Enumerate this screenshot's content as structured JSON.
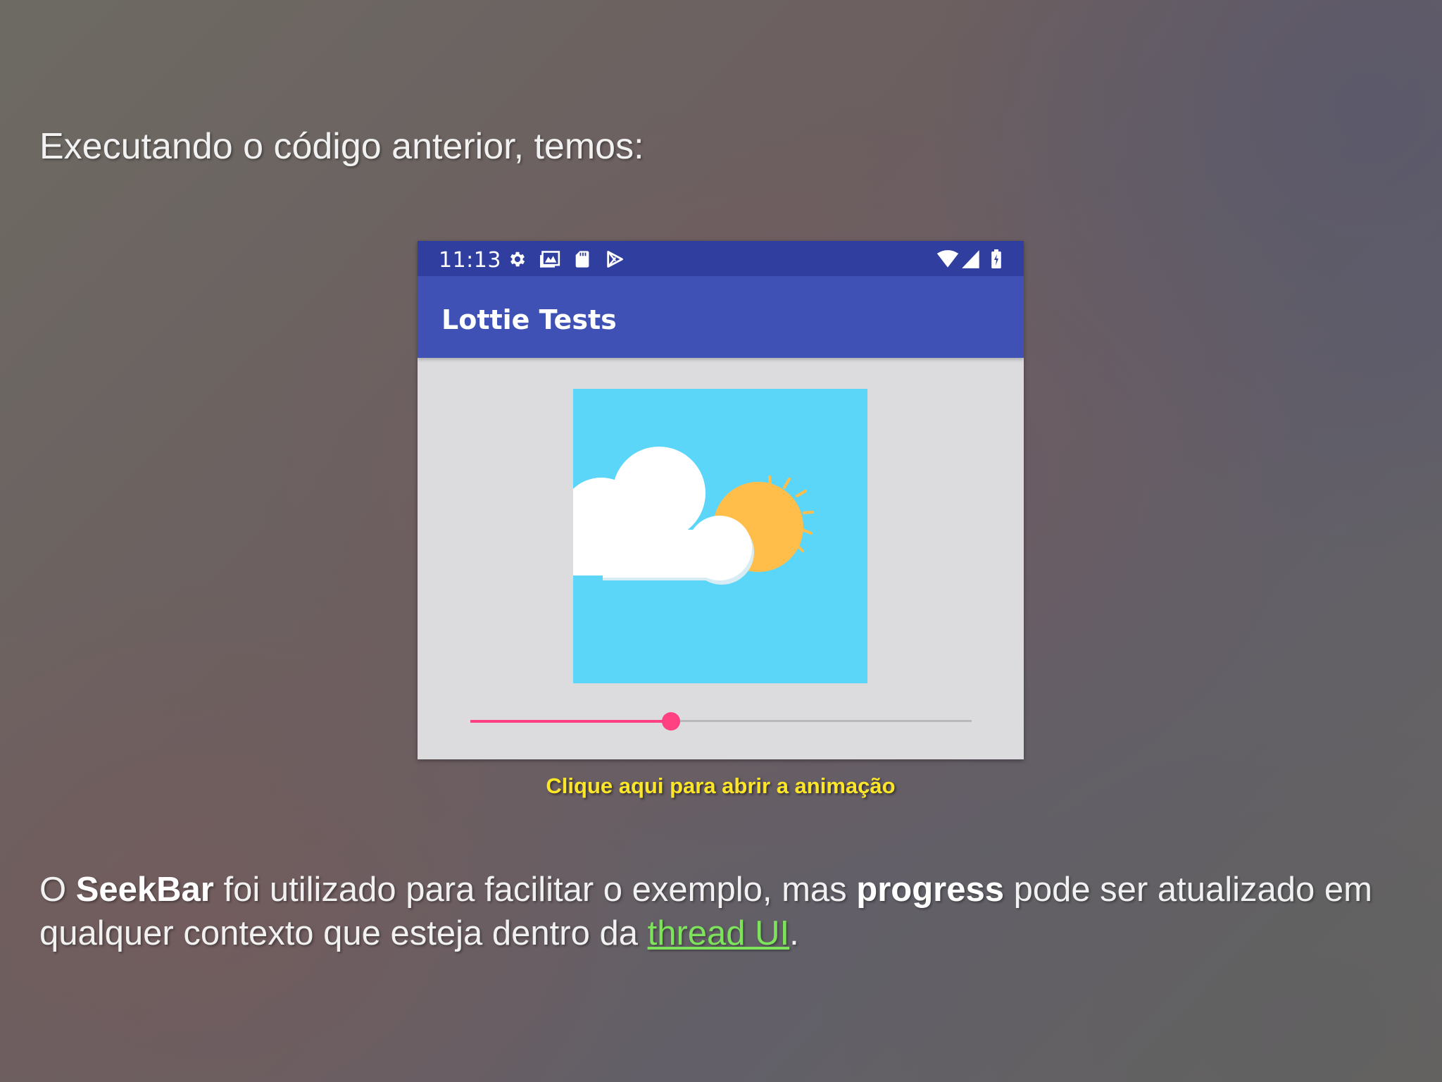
{
  "slide": {
    "heading": "Executando o código anterior, temos:",
    "caption_link": "Clique aqui para abrir a animação",
    "body": {
      "part1": "O ",
      "bold1": "SeekBar",
      "part2": " foi utilizado para facilitar o exemplo, mas ",
      "bold2": "progress",
      "part3": " pode ser atualizado em qualquer contexto que esteja dentro da ",
      "link": "thread UI",
      "part4": "."
    }
  },
  "phone": {
    "status_bar": {
      "time": "11:13",
      "left_icons": [
        "settings-icon",
        "gallery-icon",
        "sd-card-icon",
        "play-store-icon"
      ],
      "right_icons": [
        "wifi-icon",
        "signal-icon",
        "battery-charging-icon"
      ]
    },
    "app_bar": {
      "title": "Lottie Tests"
    },
    "animation": {
      "content": [
        "cloud",
        "sun"
      ]
    },
    "seekbar": {
      "progress": 0.4
    }
  },
  "colors": {
    "status_bar": "#303f9f",
    "app_bar": "#3f51b5",
    "screen_background": "#dcdcde",
    "animation_background": "#5bd6f8",
    "sun": "#ffbd4a",
    "cloud": "#ffffff",
    "seekbar_accent": "#ff4081",
    "seekbar_track": "#b9b9bd",
    "caption": "#fbe629",
    "link": "#7ce35a"
  }
}
